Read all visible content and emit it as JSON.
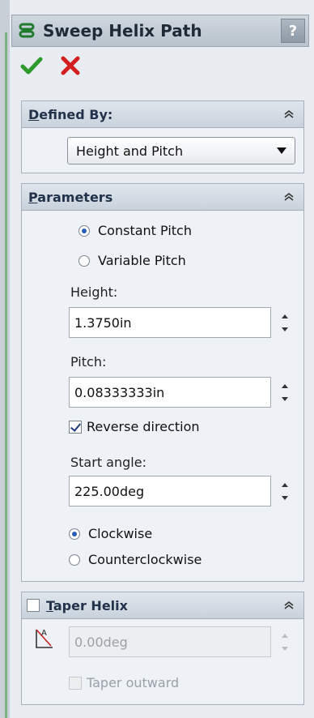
{
  "header": {
    "title": "Sweep Helix Path",
    "help_label": "?"
  },
  "actions": {
    "ok_icon": "checkmark-icon",
    "cancel_icon": "x-icon"
  },
  "defined_by": {
    "title_prefix": "D",
    "title_rest": "efined By:",
    "selected": "Height and Pitch"
  },
  "parameters": {
    "title_prefix": "P",
    "title_rest": "arameters",
    "pitch_modes": [
      "Constant Pitch",
      "Variable Pitch"
    ],
    "pitch_mode_selected": "Constant Pitch",
    "height_label": "Height:",
    "height_value": "1.3750in",
    "pitch_label": "Pitch:",
    "pitch_value": "0.08333333in",
    "reverse_label": "Reverse direction",
    "reverse_checked": true,
    "start_angle_label": "Start angle:",
    "start_angle_value": "225.00deg",
    "directions": [
      "Clockwise",
      "Counterclockwise"
    ],
    "direction_selected": "Clockwise"
  },
  "taper_helix": {
    "title_prefix": "T",
    "title_rest": "aper Helix",
    "enabled": false,
    "angle_value": "0.00deg",
    "taper_outward_label": "Taper outward",
    "taper_outward_checked": false
  },
  "colors": {
    "accent_blue": "#2a5db5",
    "ok_green": "#2e9a2e",
    "cancel_red": "#d21f1f"
  }
}
